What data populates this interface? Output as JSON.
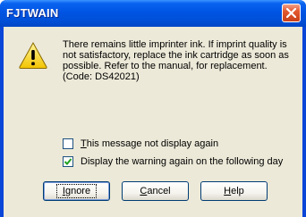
{
  "window": {
    "title": "FJTWAIN"
  },
  "icons": {
    "warning": "warning-icon",
    "close": "close-icon"
  },
  "message": "There remains little imprinter ink. If imprint quality is not satisfactory, replace the ink cartridge as soon as possible. Refer to the manual, for replacement. (Code: DS42021)",
  "options": [
    {
      "access_key": "T",
      "label_rest": "his message not display again",
      "checked": false
    },
    {
      "access_key": "",
      "label_rest": "Display the warning again on the following day",
      "checked": true
    }
  ],
  "buttons": {
    "ignore": {
      "access_key": "I",
      "rest": "gnore"
    },
    "cancel": {
      "access_key": "C",
      "rest": "ancel"
    },
    "help": {
      "access_key": "H",
      "rest": "elp"
    }
  },
  "colors": {
    "titlebar": "#0054e3",
    "dialog_bg": "#ece9d8",
    "close_button": "#e2592f"
  }
}
